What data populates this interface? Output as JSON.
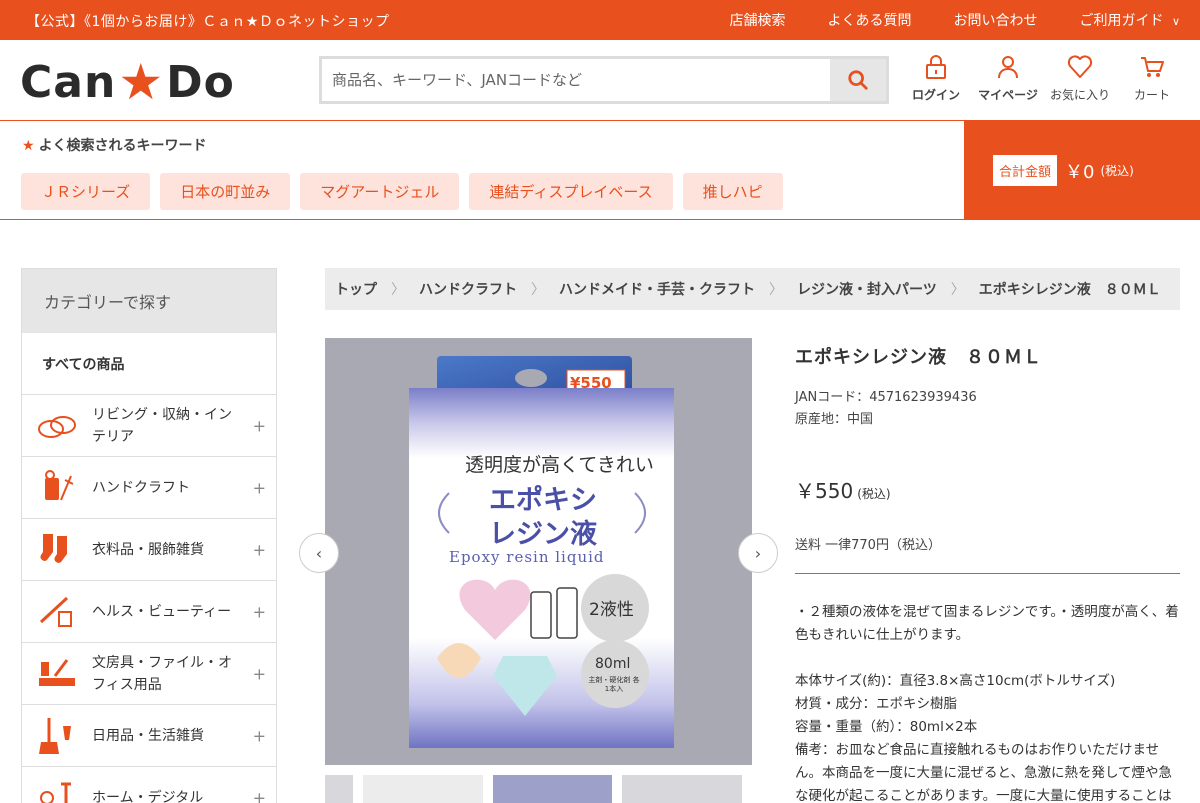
{
  "topbar": {
    "tagline": "【公式】《1個からお届け》Ｃａｎ★Ｄｏネットショップ",
    "links": [
      "店舗検索",
      "よくある質問",
      "お問い合わせ",
      "ご利用ガイド"
    ]
  },
  "header": {
    "logo_text_left": "Can",
    "logo_star": "★",
    "logo_text_right": "Do",
    "search_placeholder": "商品名、キーワード、JANコードなど",
    "icons": [
      {
        "label": "ログイン",
        "icon": "lock-icon"
      },
      {
        "label": "マイページ",
        "icon": "user-icon"
      },
      {
        "label": "お気に入り",
        "icon": "heart-icon"
      },
      {
        "label": "カート",
        "icon": "cart-icon"
      }
    ]
  },
  "keywords": {
    "title": "よく検索されるキーワード",
    "items": [
      "ＪＲシリーズ",
      "日本の町並み",
      "マグアートジェル",
      "連結ディスプレイベース",
      "推しハピ"
    ]
  },
  "total": {
    "label": "合計金額",
    "amount": "￥0",
    "tax": "(税込)"
  },
  "sidebar": {
    "heading": "カテゴリーで探す",
    "all": "すべての商品",
    "categories": [
      {
        "label": "リビング・収納・インテリア",
        "icon": "living-icon"
      },
      {
        "label": "ハンドクラフト",
        "icon": "craft-icon"
      },
      {
        "label": "衣料品・服飾雑貨",
        "icon": "socks-icon"
      },
      {
        "label": "ヘルス・ビューティー",
        "icon": "beauty-icon"
      },
      {
        "label": "文房具・ファイル・オフィス用品",
        "icon": "stationery-icon"
      },
      {
        "label": "日用品・生活雑貨",
        "icon": "daily-goods-icon"
      },
      {
        "label": "ホーム・デジタル",
        "icon": "home-digital-icon"
      }
    ]
  },
  "breadcrumb": [
    "トップ",
    "ハンドクラフト",
    "ハンドメイド・手芸・クラフト",
    "レジン液・封入パーツ",
    "エポキシレジン液　８０ＭＬ"
  ],
  "product": {
    "title": "エポキシレジン液　８０ＭＬ",
    "jan": "JANコード：4571623939436",
    "origin": "原産地：中国",
    "price": "￥550",
    "price_tax": "(税込)",
    "shipping": "送料 一律770円（税込）",
    "description": "・２種類の液体を混ぜて固まるレジンです。・透明度が高く、着色もきれいに仕上がります。",
    "specs": [
      "本体サイズ(約)：直径3.8×高さ10cm(ボトルサイズ)",
      "材質・成分：エポキシ樹脂",
      "容量・重量（約）：80ml×2本",
      "備考：お皿など食品に直接触れるものはお作りいただけません。本商品を一度に大量に混ぜると、急激に熱を発して煙や急な硬化が起こることがあります。一度に大量に使用することは避け、熱が発生した際は速やかに冷却"
    ],
    "package": {
      "price_tag": "¥550",
      "catch": "透明度が高くてきれい",
      "name_line1": "エポキシ",
      "name_line2": "レジン液",
      "name_en": "Epoxy resin liquid",
      "type": "2液性",
      "volume": "80ml",
      "volume_note": "主剤・硬化剤 各1本入"
    }
  },
  "colors": {
    "brand": "#e8501e",
    "chip_bg": "#fde3db"
  }
}
